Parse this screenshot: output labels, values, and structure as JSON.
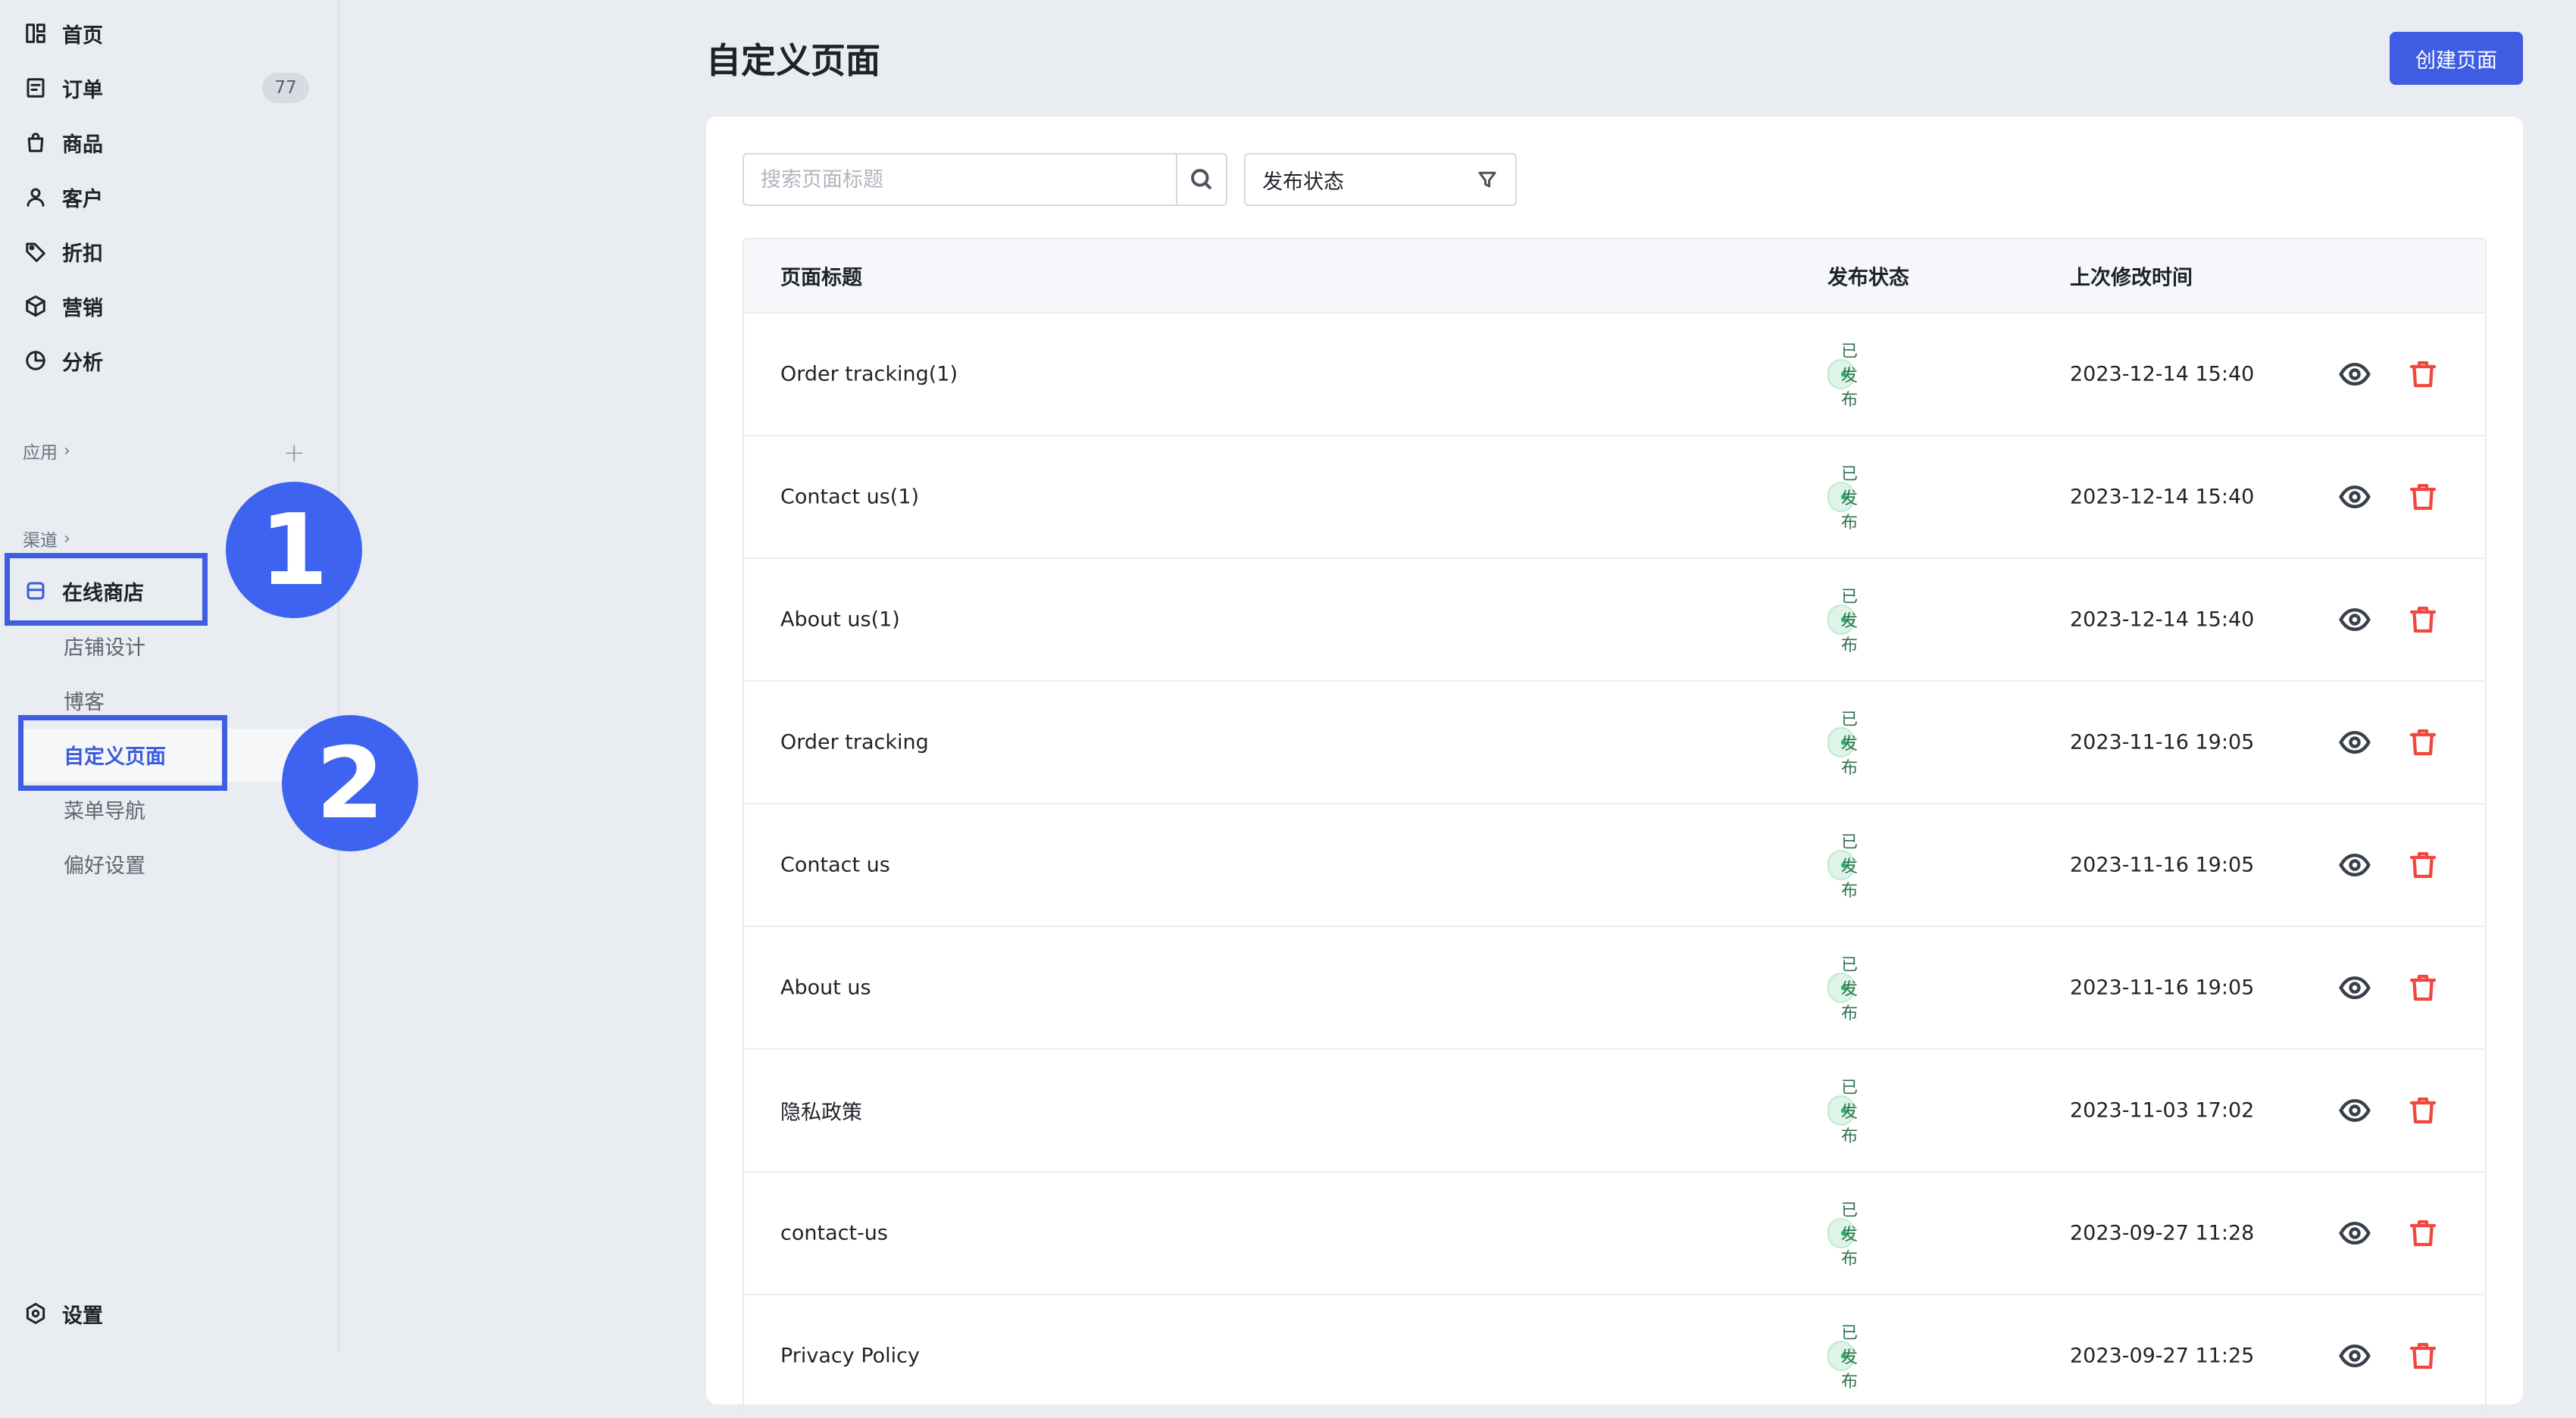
{
  "sidebar": {
    "nav": [
      {
        "label": "首页",
        "icon": "home-grid-icon"
      },
      {
        "label": "订单",
        "icon": "order-icon",
        "badge": "77"
      },
      {
        "label": "商品",
        "icon": "product-bag-icon"
      },
      {
        "label": "客户",
        "icon": "customer-icon"
      },
      {
        "label": "折扣",
        "icon": "discount-tag-icon"
      },
      {
        "label": "营销",
        "icon": "marketing-box-icon"
      },
      {
        "label": "分析",
        "icon": "analytics-pie-icon"
      }
    ],
    "apps_label": "应用",
    "channels_label": "渠道",
    "online_store": "在线商店",
    "sub_items": [
      "店铺设计",
      "博客",
      "自定义页面",
      "菜单导航",
      "偏好设置"
    ],
    "settings": "设置"
  },
  "callouts": [
    "1",
    "2"
  ],
  "main": {
    "title": "自定义页面",
    "create_button": "创建页面",
    "search_placeholder": "搜索页面标题",
    "filter_label": "发布状态"
  },
  "table": {
    "headers": {
      "title": "页面标题",
      "status": "发布状态",
      "time": "上次修改时间"
    },
    "rows": [
      {
        "title": "Order tracking(1)",
        "status": "已发布",
        "time": "2023-12-14 15:40"
      },
      {
        "title": "Contact us(1)",
        "status": "已发布",
        "time": "2023-12-14 15:40"
      },
      {
        "title": "About us(1)",
        "status": "已发布",
        "time": "2023-12-14 15:40"
      },
      {
        "title": "Order tracking",
        "status": "已发布",
        "time": "2023-11-16 19:05"
      },
      {
        "title": "Contact us",
        "status": "已发布",
        "time": "2023-11-16 19:05"
      },
      {
        "title": "About us",
        "status": "已发布",
        "time": "2023-11-16 19:05"
      },
      {
        "title": "隐私政策",
        "status": "已发布",
        "time": "2023-11-03 17:02"
      },
      {
        "title": "contact-us",
        "status": "已发布",
        "time": "2023-09-27 11:28"
      },
      {
        "title": "Privacy Policy",
        "status": "已发布",
        "time": "2023-09-27 11:25"
      }
    ]
  },
  "colors": {
    "accent": "#3f5de3",
    "published_bg": "#dcf5e7",
    "delete": "#f0483e"
  }
}
